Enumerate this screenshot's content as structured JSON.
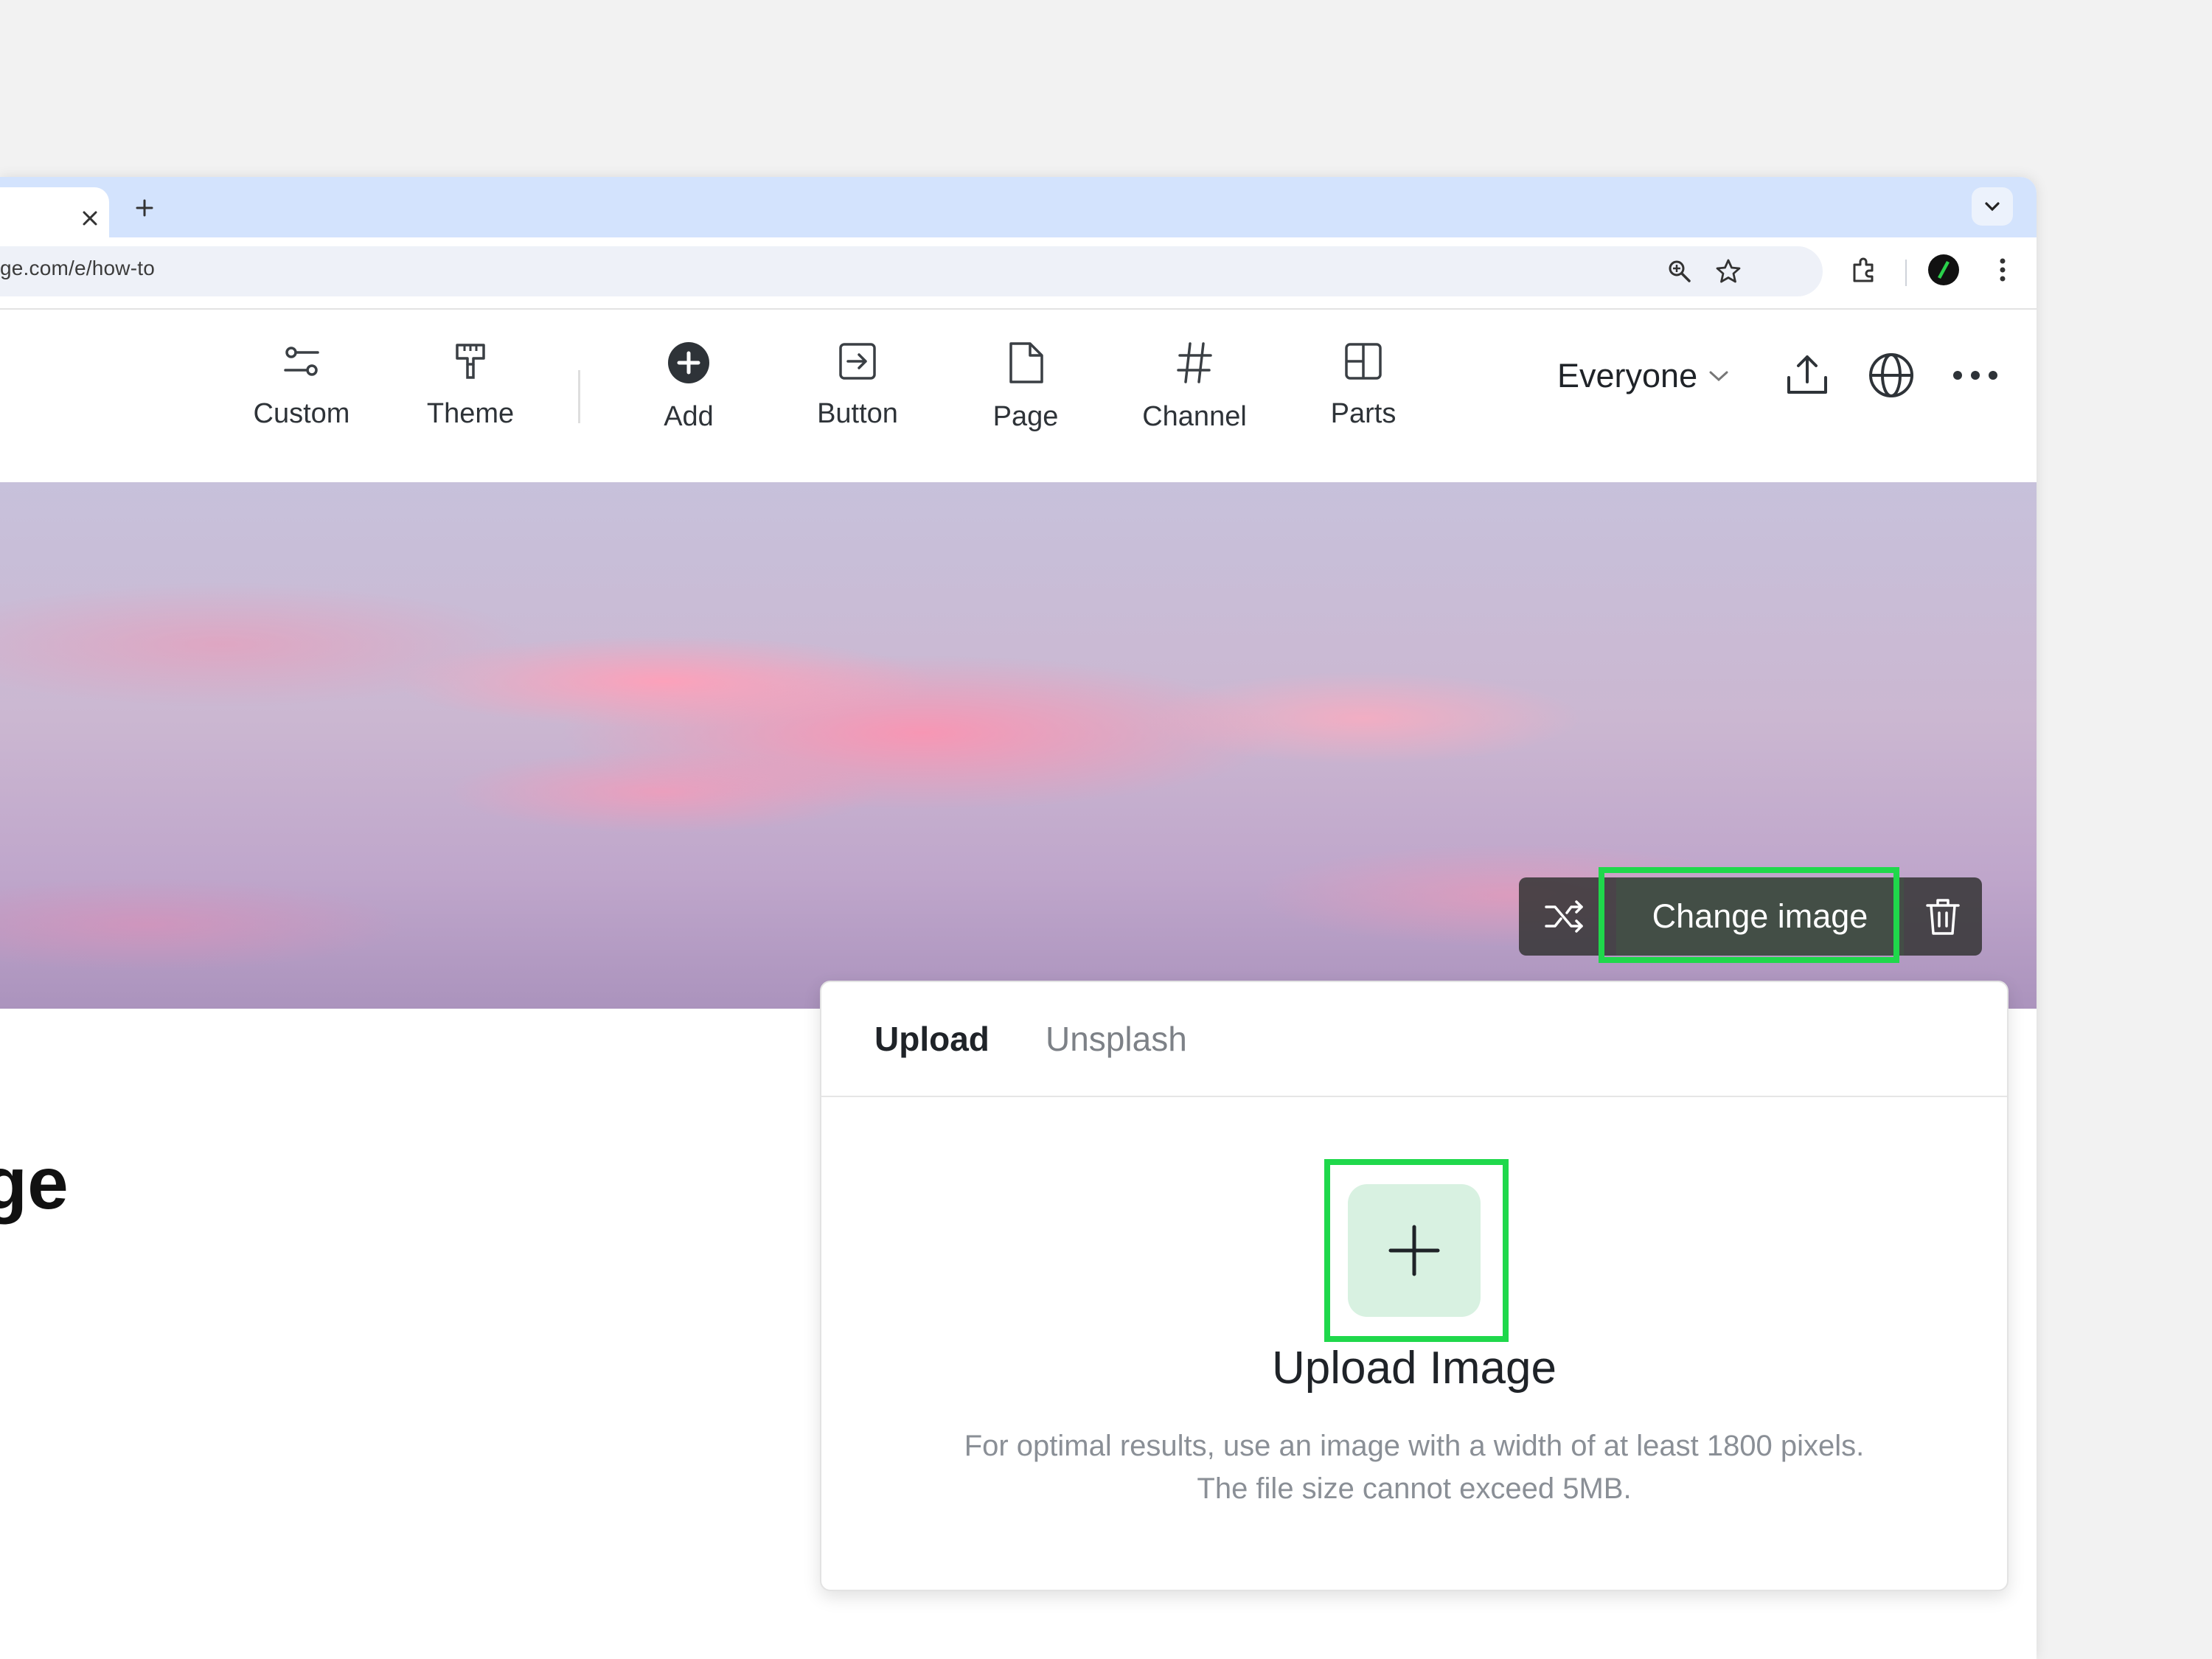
{
  "browser": {
    "url": "ge.com/e/how-to"
  },
  "toolbar": {
    "items": [
      {
        "label": "Custom",
        "icon": "sliders-icon"
      },
      {
        "label": "Theme",
        "icon": "paint-roller-icon"
      },
      {
        "label": "Add",
        "icon": "plus-circle-icon"
      },
      {
        "label": "Button",
        "icon": "button-arrow-icon"
      },
      {
        "label": "Page",
        "icon": "page-icon"
      },
      {
        "label": "Channel",
        "icon": "hash-icon"
      },
      {
        "label": "Parts",
        "icon": "layout-icon"
      }
    ],
    "audience": "Everyone"
  },
  "cover": {
    "change_label": "Change image"
  },
  "page": {
    "title_fragment": "ge"
  },
  "upload_panel": {
    "tabs": [
      "Upload",
      "Unsplash"
    ],
    "active_tab": "Upload",
    "title": "Upload Image",
    "hint_line1": "For optimal results, use an image with a width of at least 1800 pixels.",
    "hint_line2": "The file size cannot exceed 5MB."
  },
  "colors": {
    "highlight": "#1fd84b",
    "tab_strip": "#d3e3fd",
    "upload_tile": "#d8f1e1"
  }
}
